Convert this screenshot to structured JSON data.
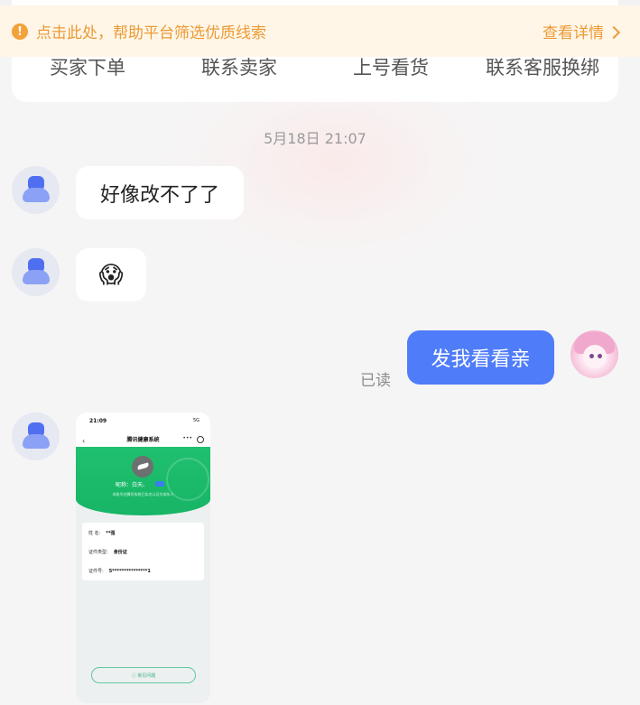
{
  "banner": {
    "message": "点击此处，帮助平台筛选优质线索",
    "detail_label": "查看详情"
  },
  "actions": [
    "买家下单",
    "联系卖家",
    "上号看货",
    "联系客服换绑"
  ],
  "chat": {
    "timestamp": "5月18日 21:07",
    "incoming_text_1": "好像改不了了",
    "incoming_emoji": "😱",
    "outgoing_text": "发我看看亲",
    "read_status": "已读"
  },
  "screenshot": {
    "status_time": "21:09",
    "status_icons": "5G",
    "nav_title": "腾讯健康系统",
    "nickname": "昵称：白天、",
    "subtitle": "本账号在腾讯系统已实名认证为成年人",
    "rows": [
      {
        "label": "姓  名:",
        "value": "**强"
      },
      {
        "label": "证件类型:",
        "value": "身份证"
      },
      {
        "label": "证件号:",
        "value": "5***************1"
      }
    ],
    "faq_label": "常见问题"
  },
  "colors": {
    "accent_blue": "#4f7cf8",
    "banner_orange": "#ec9a34",
    "health_green": "#1fc06f"
  }
}
